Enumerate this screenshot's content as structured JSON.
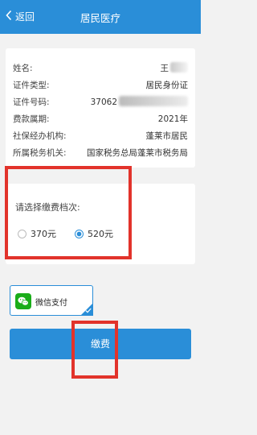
{
  "header": {
    "back_label": "返回",
    "title": "居民医疗"
  },
  "info": {
    "rows": [
      {
        "label": "姓名:",
        "value": "王"
      },
      {
        "label": "证件类型:",
        "value": "居民身份证"
      },
      {
        "label": "证件号码:",
        "value": "37062"
      },
      {
        "label": "费款属期:",
        "value": "2021年"
      },
      {
        "label": "社保经办机构:",
        "value": "蓬莱市居民"
      },
      {
        "label": "所属税务机关:",
        "value": "国家税务总局蓬莱市税务局"
      }
    ]
  },
  "tier": {
    "label": "请选择缴费档次:",
    "options": [
      {
        "label": "370元",
        "selected": false
      },
      {
        "label": "520元",
        "selected": true
      }
    ]
  },
  "payment": {
    "method_label": "微信支付",
    "selected": true
  },
  "pay_button": {
    "label": "缴费"
  },
  "colors": {
    "primary": "#2a8ed8",
    "highlight": "#e2332b",
    "wechat": "#1aad19"
  }
}
